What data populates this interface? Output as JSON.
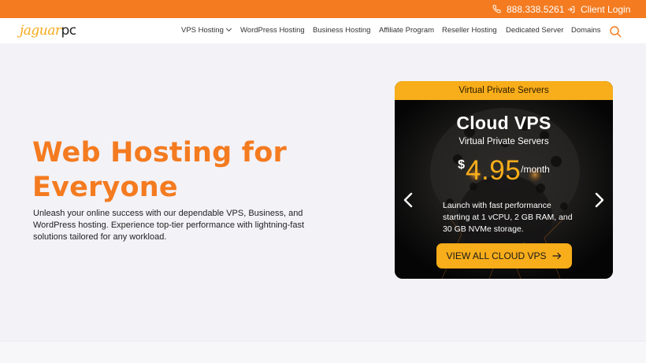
{
  "topbar": {
    "phone": "888.338.5261",
    "login": "Client Login",
    "background": "#f47b20"
  },
  "logo": {
    "part1": "jaguar",
    "part2": "pc"
  },
  "nav": {
    "items": [
      {
        "label": "VPS Hosting",
        "dropdown": true
      },
      {
        "label": "WordPress Hosting"
      },
      {
        "label": "Business Hosting"
      },
      {
        "label": "Affiliate Program"
      },
      {
        "label": "Reseller Hosting"
      },
      {
        "label": "Dedicated Server"
      },
      {
        "label": "Domains"
      }
    ],
    "search_icon": "search-icon"
  },
  "hero": {
    "title": "Web Hosting for Everyone",
    "text": "Unleash your online success with our dependable VPS, Business, and WordPress hosting. Experience top-tier performance with lightning-fast solutions tailored for any workload."
  },
  "card": {
    "header": "Virtual Private Servers",
    "title": "Cloud VPS",
    "subtitle": "Virtual Private Servers",
    "currency": "$",
    "price": "4.95",
    "period": "/month",
    "description": "Launch with fast performance starting at 1 vCPU, 2 GB RAM, and 30 GB NVMe storage.",
    "cta": "VIEW ALL CLOUD VPS",
    "accent": "#f8ad1a"
  }
}
